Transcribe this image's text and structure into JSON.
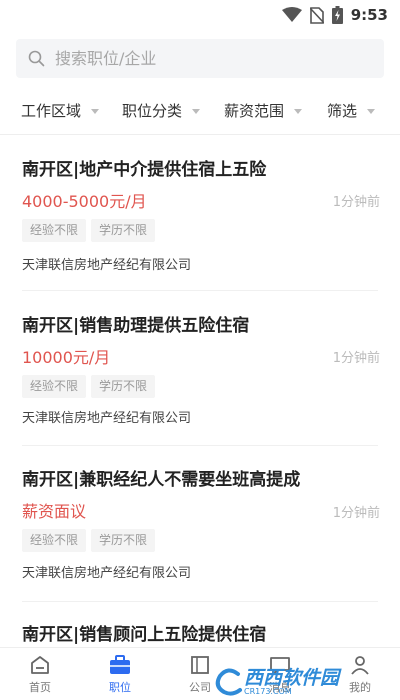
{
  "status_bar": {
    "time": "9:53"
  },
  "search": {
    "placeholder": "搜索职位/企业"
  },
  "filters": [
    {
      "label": "工作区域"
    },
    {
      "label": "职位分类"
    },
    {
      "label": "薪资范围"
    },
    {
      "label": "筛选"
    }
  ],
  "jobs": [
    {
      "title": "南开区|地产中介提供住宿上五险",
      "salary": "4000-5000元/月",
      "time": "1分钟前",
      "tags": [
        "经验不限",
        "学历不限"
      ],
      "company": "天津联信房地产经纪有限公司"
    },
    {
      "title": "南开区|销售助理提供五险住宿",
      "salary": "10000元/月",
      "time": "1分钟前",
      "tags": [
        "经验不限",
        "学历不限"
      ],
      "company": "天津联信房地产经纪有限公司"
    },
    {
      "title": "南开区|兼职经纪人不需要坐班高提成",
      "salary": "薪资面议",
      "time": "1分钟前",
      "tags": [
        "经验不限",
        "学历不限"
      ],
      "company": "天津联信房地产经纪有限公司"
    },
    {
      "title": "南开区|销售顾问上五险提供住宿"
    }
  ],
  "bottom_nav": [
    {
      "label": "首页",
      "icon": "home-icon",
      "active": false
    },
    {
      "label": "职位",
      "icon": "briefcase-icon",
      "active": true
    },
    {
      "label": "公司",
      "icon": "building-icon",
      "active": false
    },
    {
      "label": "消息",
      "icon": "message-icon",
      "active": false
    },
    {
      "label": "我的",
      "icon": "user-icon",
      "active": false
    }
  ],
  "watermark": {
    "main": "西西软件园",
    "sub": "CR173.COM"
  },
  "colors": {
    "accent": "#2d6bf0",
    "salary": "#e0554f"
  }
}
